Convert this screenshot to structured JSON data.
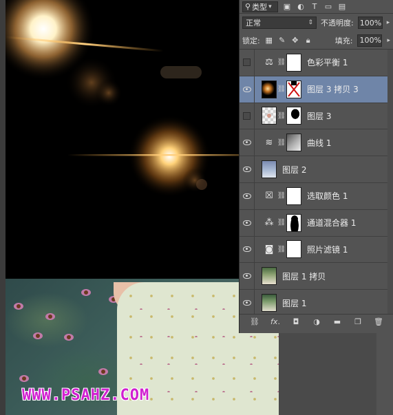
{
  "watermark": "WWW.PSAHZ.COM",
  "panel": {
    "filter": {
      "label": "类型",
      "icons": [
        "image-filter-icon",
        "adjustment-filter-icon",
        "type-filter-icon",
        "shape-filter-icon",
        "smart-object-filter-icon"
      ]
    },
    "blend_mode": "正常",
    "opacity_label": "不透明度:",
    "opacity_value": "100%",
    "lock_label": "锁定:",
    "fill_label": "填充:",
    "fill_value": "100%",
    "layers": [
      {
        "name": "色彩平衡 1",
        "visible": false,
        "kind": "adjustment",
        "icon": "⚖",
        "selected": false
      },
      {
        "name": "图层 3 拷贝 3",
        "visible": true,
        "kind": "pixel-mask",
        "selected": true
      },
      {
        "name": "图层 3",
        "visible": false,
        "kind": "pixel-mask",
        "selected": false
      },
      {
        "name": "曲线 1",
        "visible": true,
        "kind": "adjustment",
        "icon": "≋",
        "selected": false
      },
      {
        "name": "图层 2",
        "visible": true,
        "kind": "pixel",
        "selected": false
      },
      {
        "name": "选取颜色 1",
        "visible": true,
        "kind": "adjustment",
        "icon": "☒",
        "selected": false
      },
      {
        "name": "通道混合器 1",
        "visible": true,
        "kind": "adjustment",
        "icon": "⁂",
        "selected": false
      },
      {
        "name": "照片滤镜 1",
        "visible": true,
        "kind": "adjustment",
        "icon": "◙",
        "selected": false
      },
      {
        "name": "图层 1 拷贝",
        "visible": true,
        "kind": "pixel",
        "selected": false
      },
      {
        "name": "图层 1",
        "visible": true,
        "kind": "pixel",
        "selected": false
      }
    ],
    "footer_icons": [
      "link-layers-icon",
      "fx-icon",
      "add-mask-icon",
      "new-adjustment-icon",
      "new-group-icon",
      "new-layer-icon",
      "delete-layer-icon"
    ]
  }
}
